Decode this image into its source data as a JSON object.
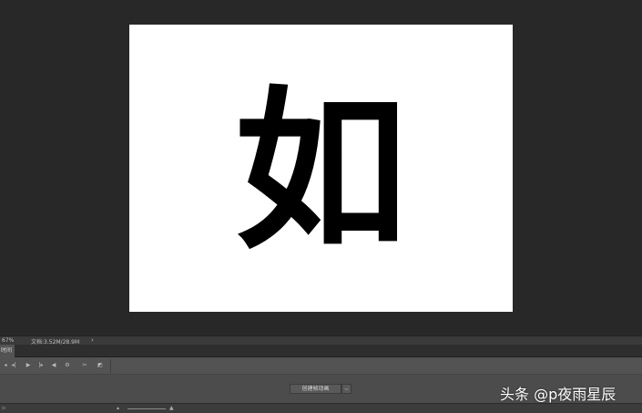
{
  "canvas": {
    "glyph": "如"
  },
  "status": {
    "zoom": "67%",
    "doc_info": "文档:3.52M/28.9M",
    "arrow": "›"
  },
  "panel": {
    "timeline_tab": "时间轴"
  },
  "toolbar": {
    "icons": [
      "first-frame-icon",
      "prev-frame-icon",
      "play-icon",
      "next-frame-icon",
      "audio-icon",
      "settings-icon",
      "scissors-icon",
      "transition-icon"
    ]
  },
  "timeline": {
    "create_button": "创建帧动画",
    "dropdown": "⌵"
  },
  "watermark": {
    "text": "头条 @p夜雨星辰"
  }
}
